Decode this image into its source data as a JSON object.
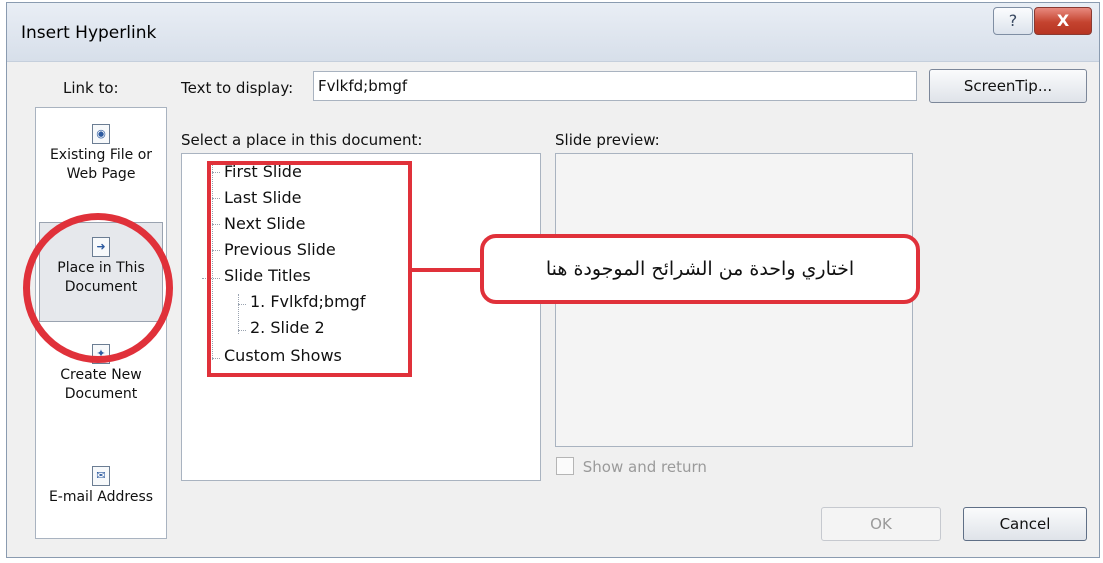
{
  "dialog": {
    "title": "Insert Hyperlink",
    "help_icon": "question-mark-icon",
    "close_icon": "close-x-icon",
    "help_glyph": "?",
    "close_glyph": "X"
  },
  "link_to": {
    "label": "Link to:",
    "items": [
      {
        "label_line1": "Existing File or",
        "label_line2": "Web Page",
        "icon": "existing-file-icon"
      },
      {
        "label_line1": "Place in This",
        "label_line2": "Document",
        "icon": "place-in-document-icon",
        "selected": true
      },
      {
        "label_line1": "Create New",
        "label_line2": "Document",
        "icon": "new-document-icon"
      },
      {
        "label_line1": "E-mail Address",
        "label_line2": "",
        "icon": "email-icon"
      }
    ]
  },
  "text_to_display": {
    "label": "Text to display:",
    "value": "Fvlkfd;bmgf"
  },
  "screentip_button": "ScreenTip...",
  "place_list": {
    "label": "Select a place in this document:",
    "items": [
      "First Slide",
      "Last Slide",
      "Next Slide",
      "Previous Slide",
      "Slide Titles",
      "1. Fvlkfd;bmgf",
      "2. Slide 2",
      "Custom Shows"
    ]
  },
  "preview": {
    "label": "Slide preview:",
    "show_and_return": "Show and return",
    "show_and_return_checked": false
  },
  "annotation": {
    "callout_text": "اختاري واحدة من الشرائح الموجودة هنا",
    "highlight_color": "#e0313a"
  },
  "buttons": {
    "ok": "OK",
    "cancel": "Cancel"
  },
  "colors": {
    "accent_red": "#e0313a",
    "dialog_bg": "#f0f0f0",
    "close_button": "#c4432f"
  }
}
